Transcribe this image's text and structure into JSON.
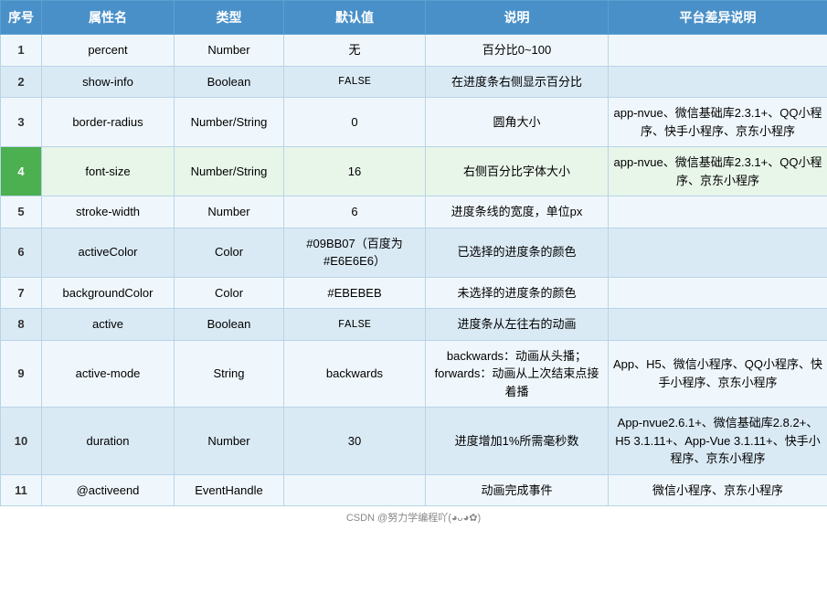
{
  "table": {
    "headers": [
      "序号",
      "属性名",
      "类型",
      "默认值",
      "说明",
      "平台差异说明"
    ],
    "rows": [
      {
        "seq": "1",
        "name": "percent",
        "type": "Number",
        "default": "无",
        "desc": "百分比0~100",
        "platform": "",
        "highlight": false
      },
      {
        "seq": "2",
        "name": "show-info",
        "type": "Boolean",
        "default": "FALSE",
        "default_mono": true,
        "desc": "在进度条右侧显示百分比",
        "platform": "",
        "highlight": false
      },
      {
        "seq": "3",
        "name": "border-radius",
        "type": "Number/String",
        "default": "0",
        "desc": "圆角大小",
        "platform": "app-nvue、微信基础库2.3.1+、QQ小程序、快手小程序、京东小程序",
        "highlight": false
      },
      {
        "seq": "4",
        "name": "font-size",
        "type": "Number/String",
        "default": "16",
        "desc": "右侧百分比字体大小",
        "platform": "app-nvue、微信基础库2.3.1+、QQ小程序、京东小程序",
        "highlight": true
      },
      {
        "seq": "5",
        "name": "stroke-width",
        "type": "Number",
        "default": "6",
        "desc": "进度条线的宽度，单位px",
        "platform": "",
        "highlight": false
      },
      {
        "seq": "6",
        "name": "activeColor",
        "type": "Color",
        "default": "#09BB07（百度为#E6E6E6）",
        "desc": "已选择的进度条的颜色",
        "platform": "",
        "highlight": false
      },
      {
        "seq": "7",
        "name": "backgroundColor",
        "type": "Color",
        "default": "#EBEBEB",
        "desc": "未选择的进度条的颜色",
        "platform": "",
        "highlight": false
      },
      {
        "seq": "8",
        "name": "active",
        "type": "Boolean",
        "default": "FALSE",
        "default_mono": true,
        "desc": "进度条从左往右的动画",
        "platform": "",
        "highlight": false
      },
      {
        "seq": "9",
        "name": "active-mode",
        "type": "String",
        "default": "backwards",
        "desc": "backwards：动画从头播；forwards：动画从上次结束点接着播",
        "platform": "App、H5、微信小程序、QQ小程序、快手小程序、京东小程序",
        "highlight": false
      },
      {
        "seq": "10",
        "name": "duration",
        "type": "Number",
        "default": "30",
        "desc": "进度增加1%所需毫秒数",
        "platform": "App-nvue2.6.1+、微信基础库2.8.2+、H5 3.1.11+、App-Vue 3.1.11+、快手小程序、京东小程序",
        "highlight": false
      },
      {
        "seq": "11",
        "name": "@activeend",
        "type": "EventHandle",
        "default": "",
        "desc": "动画完成事件",
        "platform": "微信小程序、京东小程序",
        "highlight": false
      }
    ],
    "watermark": "CSDN @努力学编程吖(◕ᴗ◕✿)"
  }
}
